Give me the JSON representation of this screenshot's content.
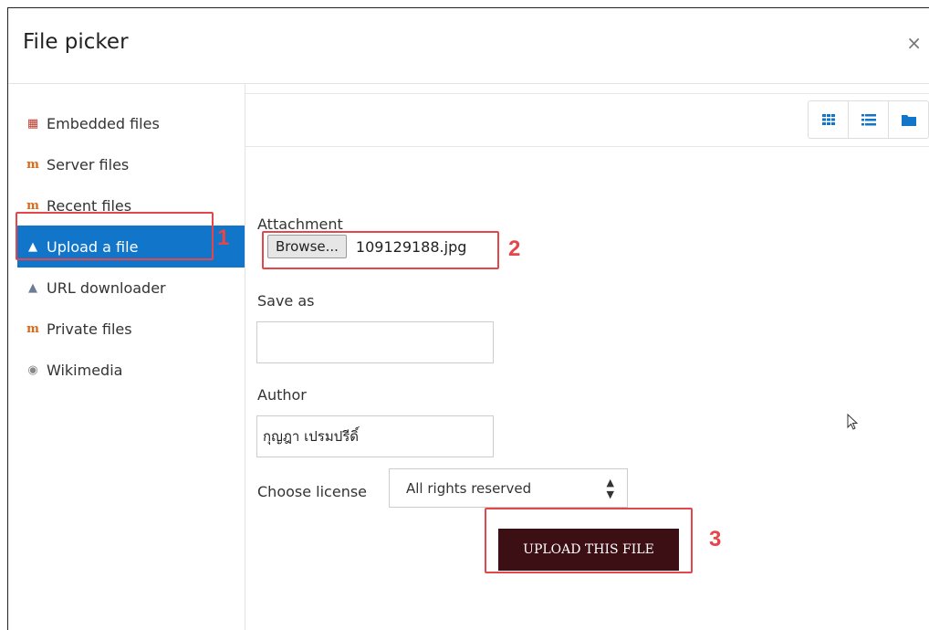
{
  "dialog": {
    "title": "File picker",
    "close_icon": "×"
  },
  "sidebar": {
    "items": [
      {
        "label": "Embedded files",
        "icon": "pdf-icon"
      },
      {
        "label": "Server files",
        "icon": "moodle-icon"
      },
      {
        "label": "Recent files",
        "icon": "moodle-icon"
      },
      {
        "label": "Upload a file",
        "icon": "upload-icon",
        "active": true
      },
      {
        "label": "URL downloader",
        "icon": "upload-icon"
      },
      {
        "label": "Private files",
        "icon": "moodle-icon"
      },
      {
        "label": "Wikimedia",
        "icon": "wikimedia-icon"
      }
    ]
  },
  "toolbar": {
    "views": [
      "grid-view-icon",
      "list-view-icon",
      "folder-view-icon"
    ]
  },
  "form": {
    "attachment_label": "Attachment",
    "browse_label": "Browse...",
    "file_name": "109129188.jpg",
    "save_as_label": "Save as",
    "save_as_value": "",
    "author_label": "Author",
    "author_value": "กุญฎา เปรมปรีดิ์",
    "license_label": "Choose license",
    "license_value": "All rights reserved",
    "upload_button": "UPLOAD THIS FILE"
  },
  "callouts": [
    "1",
    "2",
    "3"
  ],
  "colors": {
    "active": "#1175c9",
    "upload_button": "#3c0f14",
    "callout": "#e4464a"
  }
}
